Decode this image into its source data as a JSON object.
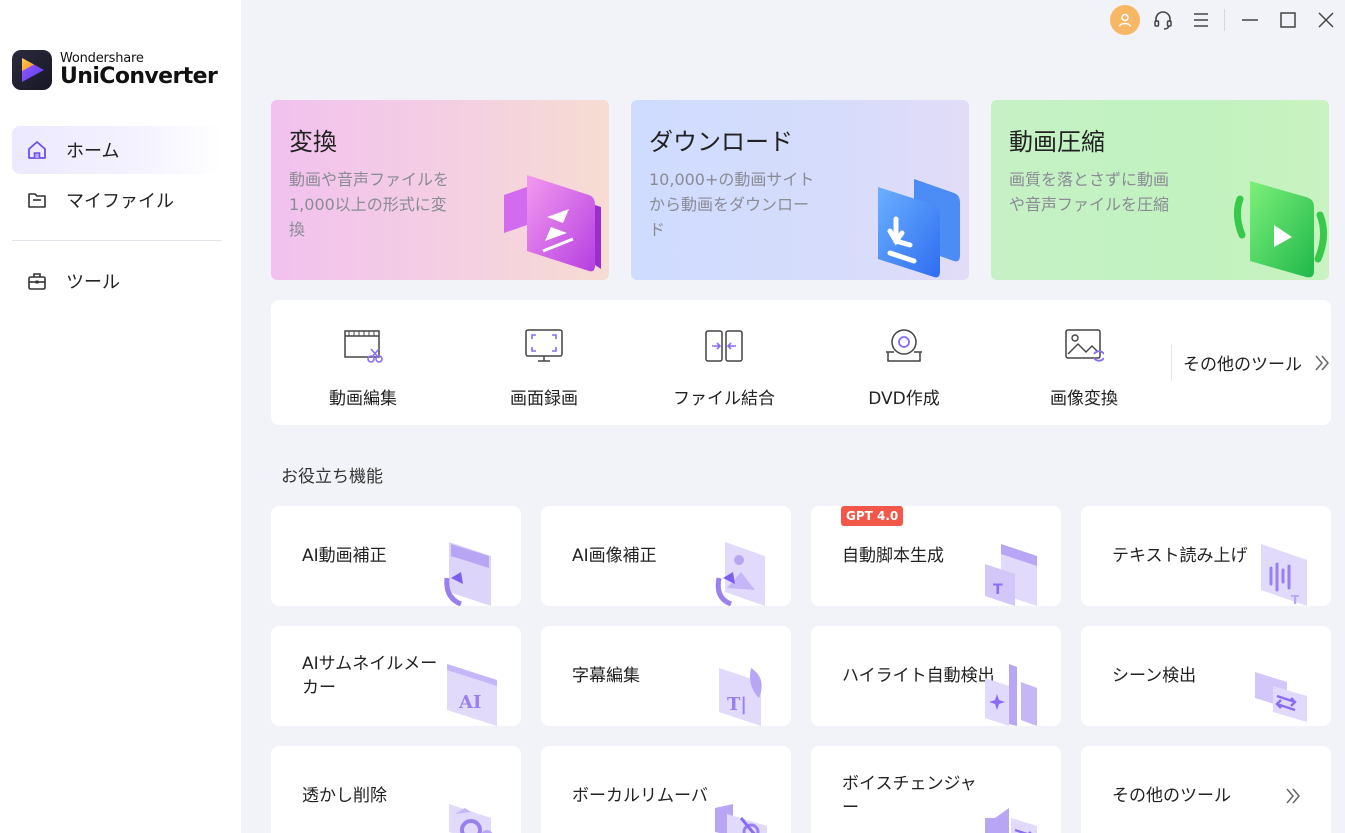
{
  "app": {
    "brand_small": "Wondershare",
    "brand_big": "UniConverter"
  },
  "sidebar": {
    "items": [
      {
        "label": "ホーム",
        "icon": "home-icon",
        "active": true
      },
      {
        "label": "マイファイル",
        "icon": "folder-icon",
        "active": false
      },
      {
        "label": "ツール",
        "icon": "toolbox-icon",
        "active": false
      }
    ]
  },
  "titlebar": {
    "icons": [
      "avatar-icon",
      "headset-icon",
      "menu-icon",
      "minimize-icon",
      "maximize-icon",
      "close-icon"
    ]
  },
  "hero": [
    {
      "title": "変換",
      "desc": "動画や音声ファイルを1,000以上の形式に変換"
    },
    {
      "title": "ダウンロード",
      "desc": "10,000+の動画サイトから動画をダウンロード"
    },
    {
      "title": "動画圧縮",
      "desc": "画質を落とさずに動画や音声ファイルを圧縮"
    }
  ],
  "tools": {
    "items": [
      {
        "label": "動画編集",
        "icon": "video-edit-icon"
      },
      {
        "label": "画面録画",
        "icon": "screen-record-icon"
      },
      {
        "label": "ファイル結合",
        "icon": "merge-icon"
      },
      {
        "label": "DVD作成",
        "icon": "dvd-icon"
      },
      {
        "label": "画像変換",
        "icon": "image-convert-icon"
      }
    ],
    "more": "その他のツール"
  },
  "section": {
    "title": "お役立ち機能"
  },
  "features": [
    {
      "label": "AI動画補正"
    },
    {
      "label": "AI画像補正"
    },
    {
      "label": "自動脚本生成",
      "badge": "GPT 4.0"
    },
    {
      "label": "テキスト読み上げ"
    },
    {
      "label": "AIサムネイルメーカー"
    },
    {
      "label": "字幕編集"
    },
    {
      "label": "ハイライト自動検出"
    },
    {
      "label": "シーン検出"
    },
    {
      "label": "透かし削除"
    },
    {
      "label": "ボーカルリムーバ"
    },
    {
      "label": "ボイスチェンジャー"
    },
    {
      "label": "その他のツール"
    }
  ],
  "colors": {
    "accent": "#8b6cf5",
    "badge": "#f2574a",
    "avatar": "#f8b765"
  }
}
